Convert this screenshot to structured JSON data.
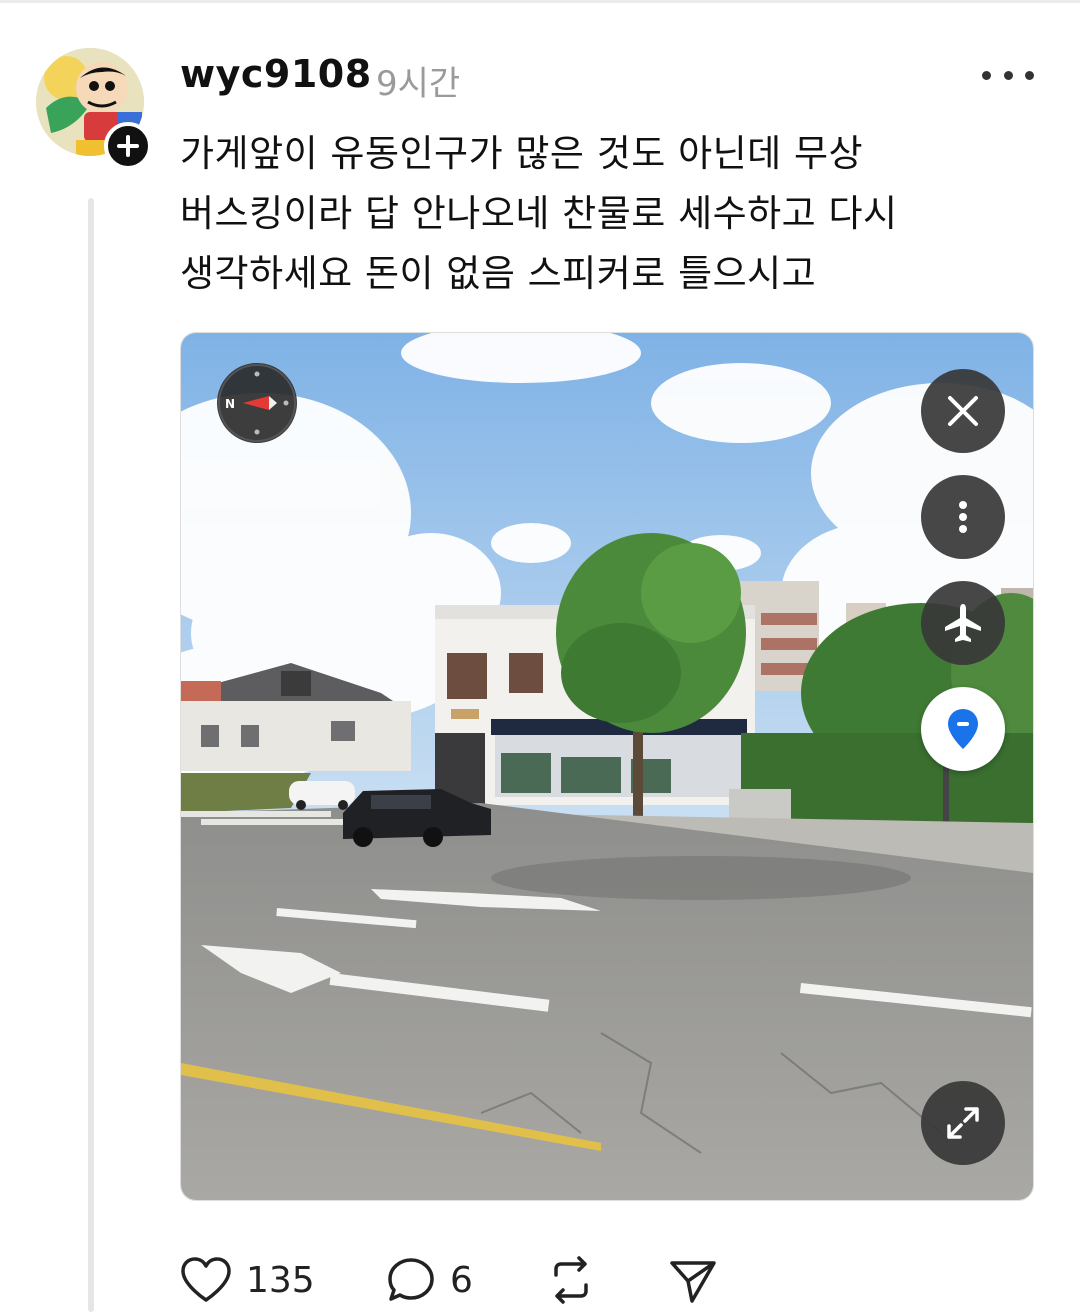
{
  "post": {
    "username": "wyc9108",
    "timestamp": "9시간",
    "text_lines": [
      "가게앞이 유동인구가 많은 것도 아닌데 무상",
      "버스킹이라 답 안나오네 찬물로 세수하고 다시",
      "생각하세요 돈이 없음 스피커로 틀으시고"
    ]
  },
  "media": {
    "type": "street-view-image",
    "compass_label": "N",
    "controls": [
      "close-icon",
      "more-vertical-icon",
      "airplane-icon",
      "location-pin-icon",
      "expand-icon"
    ]
  },
  "actions": {
    "likes": "135",
    "comments": "6"
  },
  "colors": {
    "pin_blue": "#1a73e8",
    "compass_red": "#e53935",
    "control_dark": "#373737"
  }
}
